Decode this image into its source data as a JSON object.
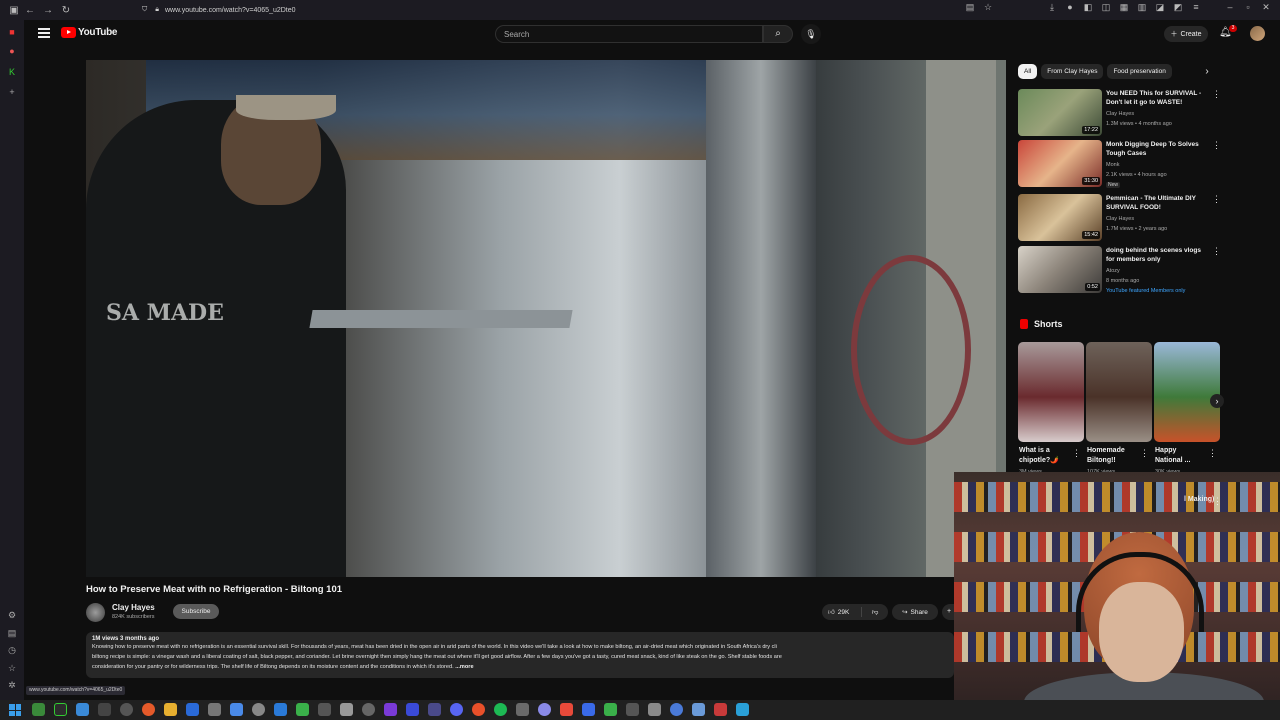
{
  "browser": {
    "url": "www.youtube.com/watch?v=4065_u2Dte0",
    "status_url": "www.youtube.com/watch?v=4065_u2Dte0"
  },
  "header": {
    "logo_text": "YouTube",
    "search_placeholder": "Search",
    "create_label": "Create",
    "notification_count": "3"
  },
  "video": {
    "title": "How to Preserve Meat with no Refrigeration - Biltong 101",
    "channel": "Clay Hayes",
    "subscribers": "824K subscribers",
    "subscribe_label": "Subscribe",
    "likes": "29K",
    "share_label": "Share",
    "overlay_text": "SA MADE",
    "description": {
      "meta": "1M views  3 months ago",
      "line1": "Knowing how to preserve meat with no refrigeration is an essential survival skill. For thousands of years, meat has been dried in the open air in arid parts of the world. In this video we'll take a look at how to make biltong, an air-dried meat which originated in South Africa's dry cli",
      "line2": "biltong recipe is simple: a vinegar wash and a liberal coating of salt, black pepper, and coriander. Let brine overnight then simply hang the meat out where it'll get good airflow. After a few days you've got a tasty, cured meat snack, kind of like steak on the go. Shelf stable foods are",
      "line3": "consideration for your pantry or for wilderness trips. The shelf life of Biltong depends on its moisture content and the conditions in which it's stored.",
      "more": "...more"
    }
  },
  "chips": [
    "All",
    "From Clay Hayes",
    "Food preservation"
  ],
  "recommendations": [
    {
      "title": "You NEED This for SURVIVAL - Don't let it go to WASTE!",
      "channel": "Clay Hayes",
      "stats": "1.3M views • 4 months ago",
      "duration": "17:22",
      "badge": ""
    },
    {
      "title": "Monk Digging Deep To Solves Tough Cases",
      "channel": "Monk",
      "stats": "2.1K views • 4 hours ago",
      "duration": "31:30",
      "badge": "New"
    },
    {
      "title": "Pemmican - The Ultimate DIY SURVIVAL FOOD!",
      "channel": "Clay Hayes",
      "stats": "1.7M views • 2 years ago",
      "duration": "15:42",
      "badge": ""
    },
    {
      "title": "doing behind the scenes vlogs for members only",
      "channel": "Atozy",
      "stats": "8 months ago",
      "duration": "0:52",
      "badge": "YouTube featured  Members only"
    }
  ],
  "shorts": {
    "heading": "Shorts",
    "items": [
      {
        "title": "What is a chipotle?🌶️",
        "views": "3M views"
      },
      {
        "title": "Homemade Biltong!!",
        "views": "107K views"
      },
      {
        "title": "Happy National ...",
        "views": "30K views"
      }
    ],
    "partial_next": "l Making)"
  },
  "colors": {
    "accent": "#ff0000",
    "background": "#0f0f0f",
    "chip": "#272727"
  }
}
